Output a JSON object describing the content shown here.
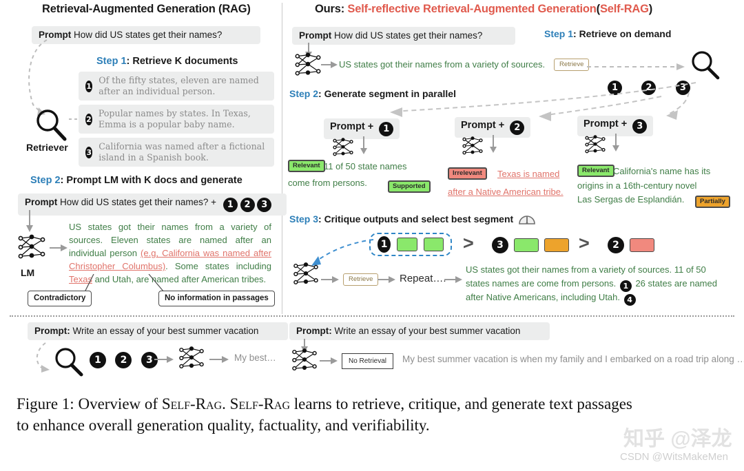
{
  "figure": {
    "caption_line1": "Figure 1: Overview of Self-Rag. Self-Rag learns to retrieve, critique, and generate text passages",
    "caption_line2": "to enhance overall generation quality, factuality, and verifiability.",
    "caption_label": "Figure 1:",
    "caption_rest1": "Overview of ",
    "caption_sc1": "Self-Rag",
    "caption_mid": ". ",
    "caption_sc2": "Self-Rag",
    "caption_rest2": " learns to retrieve, critique, and generate text passages",
    "caption_rest3": "to enhance overall generation quality, factuality, and verifiability."
  },
  "watermark": {
    "zhihu": "知乎 @泽龙",
    "csdn": "CSDN @WitsMakeMen"
  },
  "left": {
    "title": "Retrieval-Augmented Generation (RAG)",
    "prompt_label": "Prompt",
    "prompt_text": "How did US states get their names?",
    "step1": {
      "word": "Step 1",
      "text": ": Retrieve K documents"
    },
    "retriever_label": "Retriever",
    "retriever_icon": "magnifier-icon",
    "docs": [
      {
        "num": "1",
        "text": "Of the fifty states, eleven are named after an individual person."
      },
      {
        "num": "2",
        "text": "Popular names by states. In Texas, Emma is a popular baby name."
      },
      {
        "num": "3",
        "text": "California was named after a fictional island in a Spanish book."
      }
    ],
    "step2": {
      "word": "Step 2",
      "text": ": Prompt LM with K docs and generate"
    },
    "prompt2_label": "Prompt",
    "prompt2_text": "How did US states get their names? +",
    "prompt2_nums": [
      "1",
      "2",
      "3"
    ],
    "lm_label": "LM",
    "lm_icon": "neural-network-icon",
    "generation": {
      "seg_green_1": "US states got their names from a variety of sources. Eleven states are named after an individual person ",
      "seg_red_1": "(e.g, California was named after Christopher Columbus)",
      "seg_green_2": ". Some states including ",
      "seg_red_2": "Texas",
      "seg_green_3": " and Utah, are named after American tribes."
    },
    "callouts": {
      "contradictory": "Contradictory",
      "no_info": "No information in passages"
    },
    "bottom": {
      "prompt_label": "Prompt:",
      "prompt_text": "Write an essay of your best summer vacation",
      "nums": [
        "1",
        "2",
        "3"
      ],
      "output": "My best…",
      "search_icon": "magnifier-icon",
      "lm_icon": "neural-network-icon"
    }
  },
  "right": {
    "title_ours": "Ours:",
    "title_main": "Self-reflective Retrieval-Augmented Generation",
    "title_paren_open": "(",
    "title_tag": "Self-RAG",
    "title_paren_close": ")",
    "prompt_label": "Prompt",
    "prompt_text": "How did US states get their names?",
    "step1": {
      "word": "Step 1",
      "text": ": Retrieve on demand"
    },
    "lm_icon": "neural-network-icon",
    "first_gen": "US states got their names from a variety of sources.",
    "retrieve_token": "Retrieve",
    "search_icon": "magnifier-icon",
    "retrieved_nums": [
      "1",
      "2",
      "3"
    ],
    "step2": {
      "word": "Step 2",
      "text": ": Generate segment in parallel"
    },
    "branches": [
      {
        "header_label": "Prompt +",
        "header_num": "1",
        "lm_icon": "neural-network-icon",
        "badge_relevance": "Relevant",
        "badge_relevance_color": "#8ae86b",
        "text_line1": "11 of 50 state names",
        "text_line2": "come from persons.",
        "badge_support": "Supported",
        "badge_support_color": "#8ae86b",
        "text_color": "green"
      },
      {
        "header_label": "Prompt +",
        "header_num": "2",
        "lm_icon": "neural-network-icon",
        "badge_relevance": "Irrelevant",
        "badge_relevance_color": "#f1897e",
        "text_line1": "Texas is named",
        "text_line2": "after a Native American tribe.",
        "badge_support": "",
        "text_color": "red"
      },
      {
        "header_label": "Prompt +",
        "header_num": "3",
        "lm_icon": "neural-network-icon",
        "badge_relevance": "Relevant",
        "badge_relevance_color": "#8ae86b",
        "text_line1": "California's name has its",
        "text_line2": "origins in a 16th-century novel",
        "text_line3": "Las Sergas de Esplandián.",
        "badge_support": "Partially",
        "badge_support_color": "#eda32c",
        "text_color": "green"
      }
    ],
    "step3": {
      "word": "Step 3",
      "text": ": Critique outputs and select best segment"
    },
    "critique_icon": "gauge-icon",
    "ranking": [
      {
        "num": "1",
        "chips": [
          "green",
          "green"
        ],
        "selected": true
      },
      {
        "num": "3",
        "chips": [
          "green",
          "orange"
        ],
        "selected": false
      },
      {
        "num": "2",
        "chips": [
          "red"
        ],
        "selected": false
      }
    ],
    "gt_symbols": [
      ">",
      ">"
    ],
    "repeat_flow": {
      "lm_icon": "neural-network-icon",
      "retrieve_token": "Retrieve",
      "repeat_label": "Repeat…."
    },
    "final_output": {
      "line1": "US states got their names from a variety of sources. 11 of 50",
      "line2a": "states names are come from persons.",
      "line2_num": "1",
      "line2b": "26 states are named",
      "line3a": "after Native Americans, including Utah.",
      "line3_num": "4"
    },
    "bottom": {
      "prompt_label": "Prompt:",
      "prompt_text": "Write an essay of your best summer vacation",
      "lm_icon": "neural-network-icon",
      "no_retrieval_token": "No Retrieval",
      "output": "My best summer vacation is when my family and I embarked on a road trip along …"
    }
  }
}
